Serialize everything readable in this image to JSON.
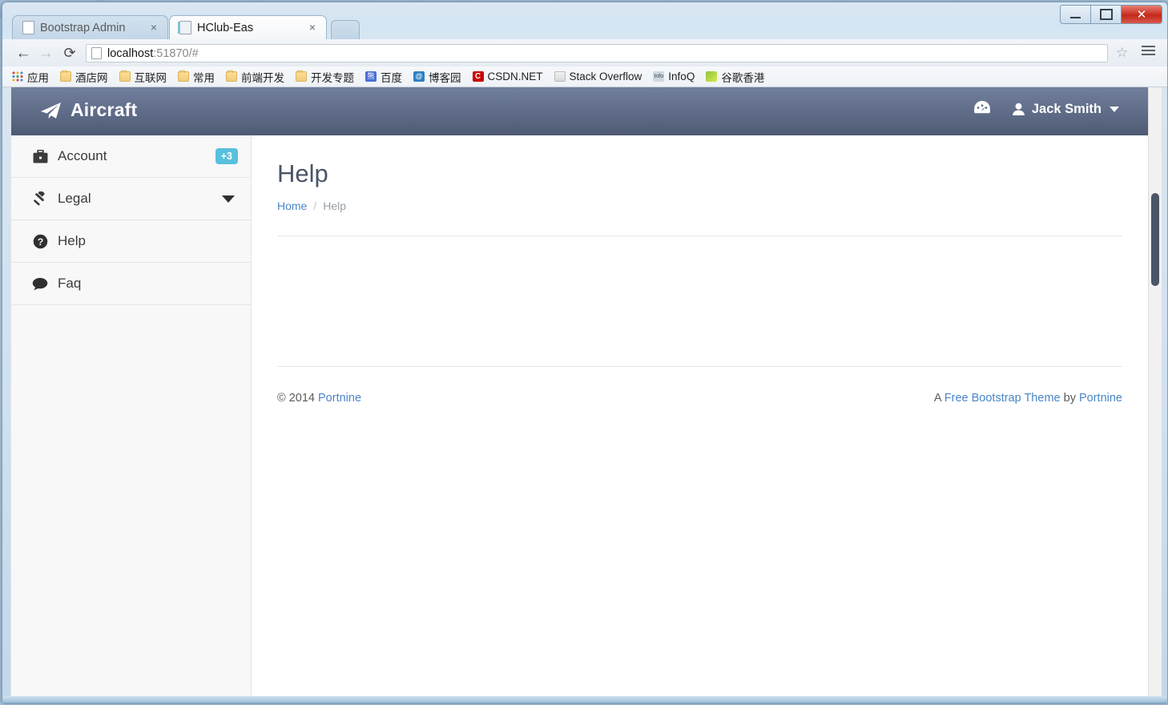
{
  "browser": {
    "tabs": [
      {
        "title": "Bootstrap Admin",
        "close_label": "×",
        "active": false
      },
      {
        "title": "HClub-Eas",
        "close_label": "×",
        "active": true
      }
    ],
    "window_controls": {
      "minimize": "minimize-button",
      "maximize": "maximize-button",
      "close": "✕"
    },
    "toolbar": {
      "back_icon": "←",
      "forward_icon": "→",
      "reload_icon": "⟳",
      "url_host": "localhost",
      "url_rest": ":51870/#",
      "star_icon": "☆"
    },
    "bookmarks": [
      {
        "label": "应用",
        "icon": "apps-grid-icon",
        "type": "apps"
      },
      {
        "label": "酒店网",
        "icon": "folder-icon",
        "type": "folder"
      },
      {
        "label": "互联网",
        "icon": "folder-icon",
        "type": "folder"
      },
      {
        "label": "常用",
        "icon": "folder-icon",
        "type": "folder"
      },
      {
        "label": "前端开发",
        "icon": "folder-icon",
        "type": "folder"
      },
      {
        "label": "开发专题",
        "icon": "folder-icon",
        "type": "folder"
      },
      {
        "label": "百度",
        "icon": "baidu-icon",
        "type": "baidu",
        "glyph": "熊"
      },
      {
        "label": "博客园",
        "icon": "cnblogs-icon",
        "type": "bokeyuan",
        "glyph": "@"
      },
      {
        "label": "CSDN.NET",
        "icon": "csdn-icon",
        "type": "csdn",
        "glyph": "C"
      },
      {
        "label": "Stack Overflow",
        "icon": "stackoverflow-icon",
        "type": "so",
        "glyph": ""
      },
      {
        "label": "InfoQ",
        "icon": "infoq-icon",
        "type": "infoq",
        "glyph": "Info"
      },
      {
        "label": "谷歌香港",
        "icon": "google-hk-icon",
        "type": "google",
        "glyph": ""
      }
    ]
  },
  "app": {
    "brand": {
      "label": "Aircraft",
      "icon": "paper-plane-icon"
    },
    "navbar": {
      "dashboard_icon": "dashboard-gauge-icon",
      "user_name": "Jack Smith",
      "user_icon": "user-icon",
      "caret_icon": "caret-down-icon"
    },
    "sidebar": {
      "items": [
        {
          "label": "Account",
          "icon": "briefcase-icon",
          "glyph": "💼",
          "badge": "+3",
          "chevron": false
        },
        {
          "label": "Legal",
          "icon": "gavel-icon",
          "glyph": "🔨",
          "badge": null,
          "chevron": true
        },
        {
          "label": "Help",
          "icon": "question-circle-icon",
          "glyph": "?",
          "badge": null,
          "chevron": false
        },
        {
          "label": "Faq",
          "icon": "comment-icon",
          "glyph": "💬",
          "badge": null,
          "chevron": false
        }
      ]
    },
    "main": {
      "page_title": "Help",
      "breadcrumb": {
        "home": "Home",
        "separator": "/",
        "current": "Help"
      }
    },
    "footer": {
      "copyright_prefix": "© 2014",
      "copyright_link": "Portnine",
      "credit_prefix": "A",
      "credit_link": "Free Bootstrap Theme",
      "credit_mid": "by",
      "credit_link2": "Portnine"
    },
    "colors": {
      "navbar_top": "#717f9c",
      "navbar_bottom": "#4f5b73",
      "badge": "#59c0dd",
      "link": "#4a86c8",
      "title": "#4a5568",
      "sidebar_bg": "#f8f8f8"
    }
  }
}
